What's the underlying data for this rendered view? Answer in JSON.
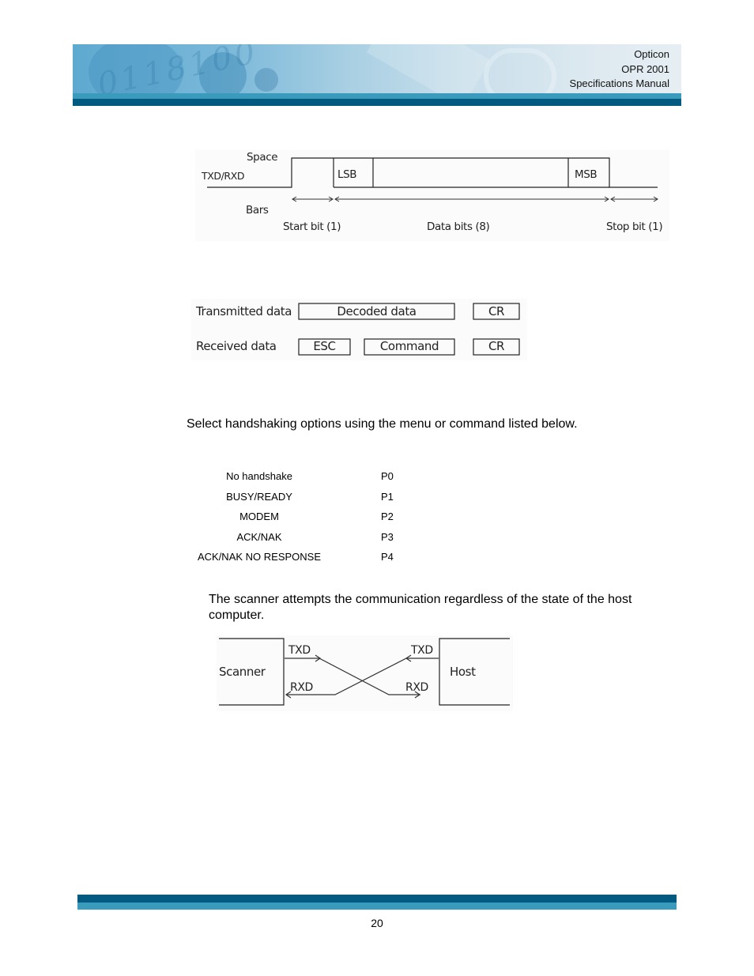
{
  "header": {
    "company": "Opticon",
    "model": "OPR 2001",
    "manual": "Specifications Manual",
    "banner_digits": "0118100",
    "colors": {
      "stripe_light": "#3a9bbc",
      "stripe_dark": "#035a80"
    }
  },
  "timing_diagram": {
    "signal_label": "TXD/RXD",
    "space_label": "Space",
    "bars_label": "Bars",
    "lsb_label": "LSB",
    "msb_label": "MSB",
    "start_bit_label": "Start bit (1)",
    "data_bits_label": "Data bits (8)",
    "stop_bit_label": "Stop bit (1)"
  },
  "data_format_diagram": {
    "transmitted_label": "Transmitted data",
    "transmitted_fields": [
      "Decoded data",
      "CR"
    ],
    "received_label": "Received data",
    "received_fields": [
      "ESC",
      "Command",
      "CR"
    ]
  },
  "handshake_intro": "Select handshaking options using the menu or command listed below.",
  "handshake_options": [
    {
      "option": "No handshake",
      "command": "P0"
    },
    {
      "option": "BUSY/READY",
      "command": "P1"
    },
    {
      "option": "MODEM",
      "command": "P2"
    },
    {
      "option": "ACK/NAK",
      "command": "P3"
    },
    {
      "option": "ACK/NAK NO RESPONSE",
      "command": "P4"
    }
  ],
  "no_handshake_description": "The scanner attempts the communication regardless of the state of the host computer.",
  "wiring_diagram": {
    "scanner_label": "Scanner",
    "host_label": "Host",
    "scanner_txd": "TXD",
    "scanner_rxd": "RXD",
    "host_txd": "TXD",
    "host_rxd": "RXD"
  },
  "footer": {
    "page_number": "20"
  }
}
